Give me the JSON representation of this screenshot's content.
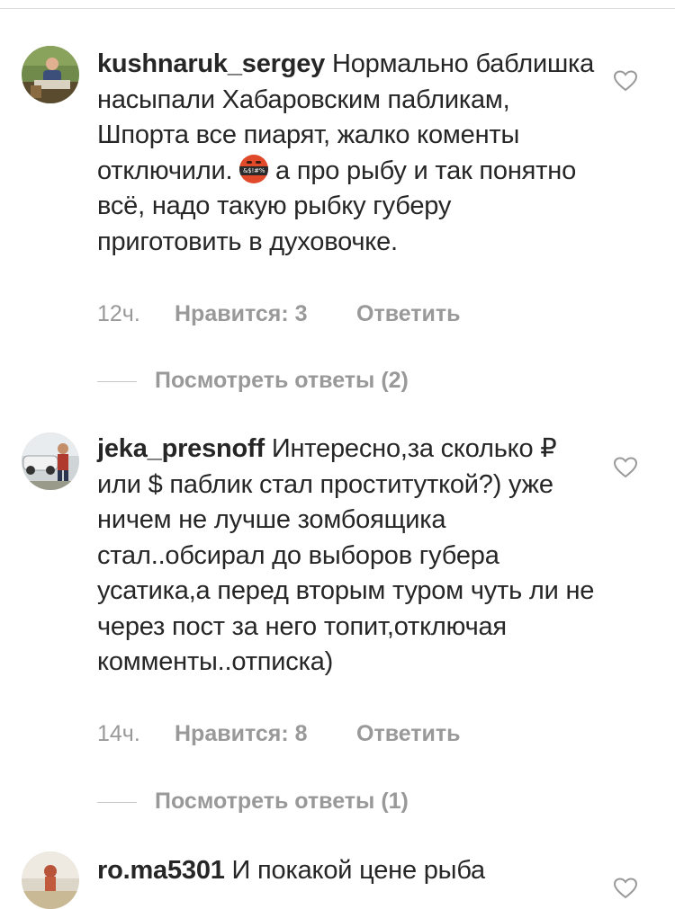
{
  "comments": [
    {
      "username": "kushnaruk_sergey",
      "text_part1": " Нормально баблишка насыпали Хабаровским пабликам, Шпорта все пиарят, жалко коменты отключили. ",
      "emoji": "angry-censored-face",
      "emoji_text": "&$!#%",
      "text_part2": "  а про рыбу и так понятно всё, надо такую рыбку губеру приготовить в духовочке.",
      "time": "12ч.",
      "likes": "Нравится: 3",
      "reply": "Ответить",
      "view_replies": "Посмотреть ответы (2)"
    },
    {
      "username": "jeka_presnoff",
      "text": " Интересно,за сколько ₽ или $ паблик стал проституткой?) уже ничем не лучше зомбоящика стал..обсирал до выборов губера усатика,а перед вторым туром чуть ли не через пост за него топит,отключая комменты..отписка)",
      "time": "14ч.",
      "likes": "Нравится: 8",
      "reply": "Ответить",
      "view_replies": "Посмотреть ответы (1)"
    },
    {
      "username": "ro.ma5301",
      "text": " И покакой цене рыба"
    }
  ],
  "colors": {
    "text": "#262626",
    "secondary": "#999999",
    "divider": "#dbdbdb"
  },
  "icons": {
    "like": "heart-outline-icon"
  }
}
